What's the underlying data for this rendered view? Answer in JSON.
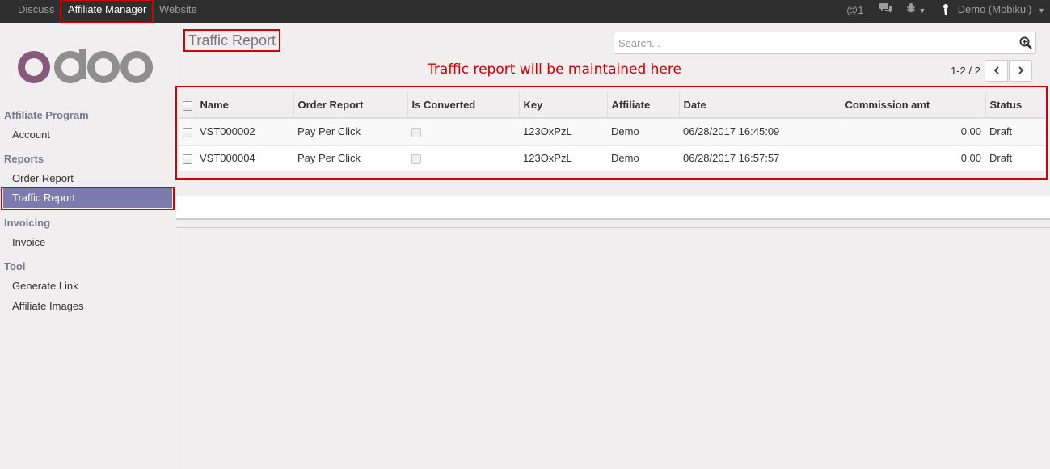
{
  "topbar": {
    "menu": [
      "Discuss",
      "Affiliate Manager",
      "Website"
    ],
    "mentions": "1",
    "user": "Demo (Mobikul)"
  },
  "sidebar": {
    "sections": [
      {
        "title": "Affiliate Program",
        "items": [
          "Account"
        ]
      },
      {
        "title": "Reports",
        "items": [
          "Order Report",
          "Traffic Report"
        ]
      },
      {
        "title": "Invoicing",
        "items": [
          "Invoice"
        ]
      },
      {
        "title": "Tool",
        "items": [
          "Generate Link",
          "Affiliate Images"
        ]
      }
    ],
    "active": "Traffic Report"
  },
  "main": {
    "title": "Traffic Report",
    "search_placeholder": "Search...",
    "annotation": "Traffic report will be maintained here",
    "pager": "1-2 / 2"
  },
  "table": {
    "columns": [
      "Name",
      "Order Report",
      "Is Converted",
      "Key",
      "Affiliate",
      "Date",
      "Commission amt",
      "Status"
    ],
    "rows": [
      {
        "name": "VST000002",
        "order_report": "Pay Per Click",
        "is_converted": false,
        "key": "123OxPzL",
        "affiliate": "Demo",
        "date": "06/28/2017 16:45:09",
        "commission": "0.00",
        "status": "Draft"
      },
      {
        "name": "VST000004",
        "order_report": "Pay Per Click",
        "is_converted": false,
        "key": "123OxPzL",
        "affiliate": "Demo",
        "date": "06/28/2017 16:57:57",
        "commission": "0.00",
        "status": "Draft"
      }
    ]
  },
  "colors": {
    "brand": "#875a7b",
    "active_menu": "#7c7bad",
    "highlight": "#d40000"
  }
}
